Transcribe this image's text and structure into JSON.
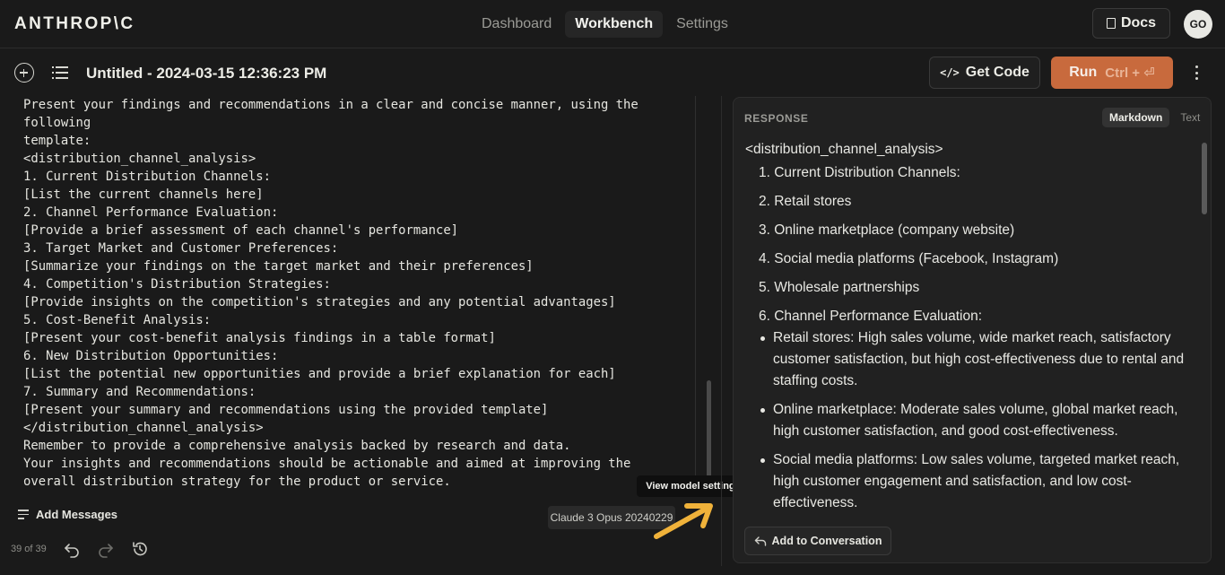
{
  "topbar": {
    "logo": "ANTHROP\\C",
    "nav": [
      "Dashboard",
      "Workbench",
      "Settings"
    ],
    "active_nav": "Workbench",
    "docs_label": "Docs",
    "avatar_initials": "GO"
  },
  "toolbar": {
    "title": "Untitled - 2024-03-15 12:36:23 PM",
    "get_code_label": "Get Code",
    "run_label": "Run",
    "run_shortcut": "Ctrl + ⏎"
  },
  "editor": {
    "lines": [
      "Present your findings and recommendations in a clear and concise manner, using the",
      "following",
      "template:",
      "<distribution_channel_analysis>",
      "1. Current Distribution Channels:",
      "[List the current channels here]",
      "2. Channel Performance Evaluation:",
      "[Provide a brief assessment of each channel's performance]",
      "3. Target Market and Customer Preferences:",
      "[Summarize your findings on the target market and their preferences]",
      "4. Competition's Distribution Strategies:",
      "[Provide insights on the competition's strategies and any potential advantages]",
      "5. Cost-Benefit Analysis:",
      "[Present your cost-benefit analysis findings in a table format]",
      "6. New Distribution Opportunities:",
      "[List the potential new opportunities and provide a brief explanation for each]",
      "7. Summary and Recommendations:",
      "[Present your summary and recommendations using the provided template]",
      "</distribution_channel_analysis>",
      "Remember to provide a comprehensive analysis backed by research and data.",
      "Your insights and recommendations should be actionable and aimed at improving the",
      "overall distribution strategy for the product or service."
    ],
    "add_messages_label": "Add Messages",
    "model_badge": "Claude 3 Opus 20240229",
    "tooltip": "View model settings",
    "history_count": "39 of 39"
  },
  "response": {
    "label": "RESPONSE",
    "format_options": [
      "Markdown",
      "Text"
    ],
    "active_format": "Markdown",
    "opening_tag": "<distribution_channel_analysis>",
    "numbered": [
      "1. Current Distribution Channels:",
      "2. Retail stores",
      "3. Online marketplace (company website)",
      "4. Social media platforms (Facebook, Instagram)",
      "5. Wholesale partnerships",
      "6. Channel Performance Evaluation:"
    ],
    "bullets": [
      "Retail stores: High sales volume, wide market reach, satisfactory customer satisfaction, but high cost-effectiveness due to rental and staffing costs.",
      "Online marketplace: Moderate sales volume, global market reach, high customer satisfaction, and good cost-effectiveness.",
      "Social media platforms: Low sales volume, targeted market reach, high customer engagement and satisfaction, and low cost-effectiveness."
    ],
    "add_conversation_label": "Add to Conversation"
  },
  "colors": {
    "background": "#1a1a1a",
    "panel": "#212121",
    "run_button": "#c86a3d",
    "text": "#e8e8e3",
    "highlight_arrow": "#f0b23a"
  }
}
